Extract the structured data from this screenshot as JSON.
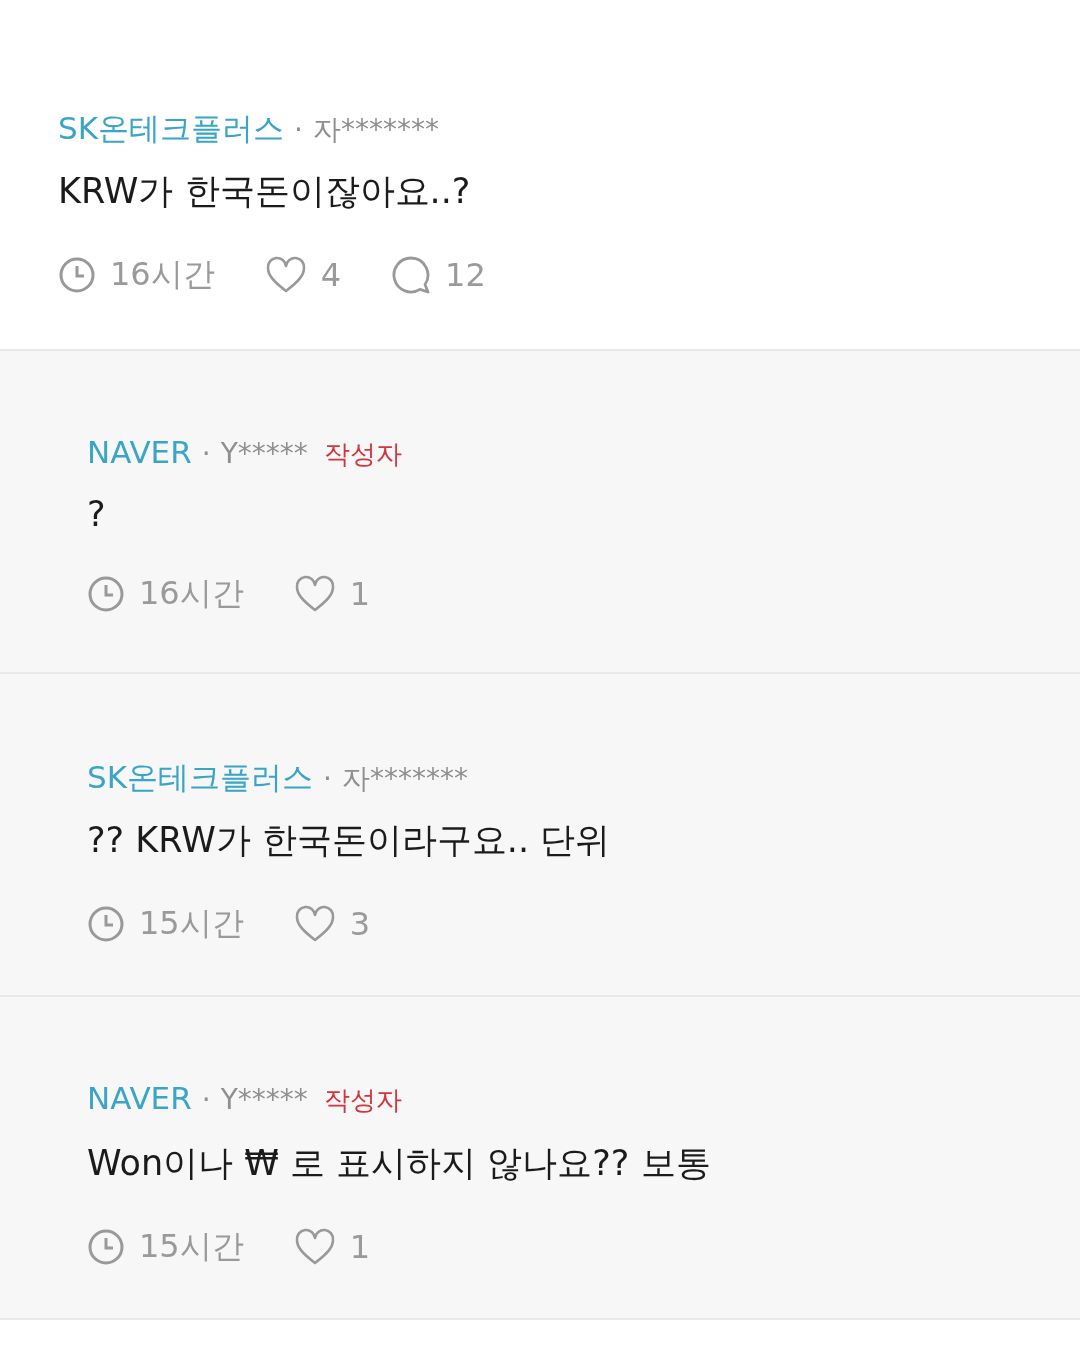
{
  "comments": [
    {
      "kind": "post",
      "company": "SK온테크플러스",
      "separator": "·",
      "user": "자*******",
      "text": "KRW가 한국돈이잖아요..?",
      "time": "16시간",
      "likes": "4",
      "replies": "12"
    },
    {
      "kind": "reply",
      "company": "NAVER",
      "separator": "·",
      "user": "Y*****",
      "badge": "작성자",
      "text": "?",
      "time": "16시간",
      "likes": "1"
    },
    {
      "kind": "reply",
      "company": "SK온테크플러스",
      "separator": "·",
      "user": "자*******",
      "text": "?? KRW가 한국돈이라구요.. 단위",
      "time": "15시간",
      "likes": "3"
    },
    {
      "kind": "reply",
      "company": "NAVER",
      "separator": "·",
      "user": "Y*****",
      "badge": "작성자",
      "text": "Won이나 ₩ 로 표시하지 않나요?? 보통",
      "time": "15시간",
      "likes": "1"
    }
  ]
}
